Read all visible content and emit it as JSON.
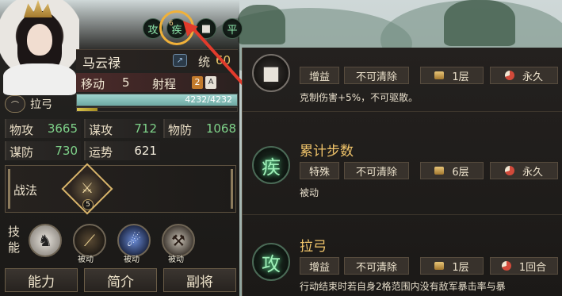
{
  "character": {
    "name": "马云禄",
    "leadership_label": "统",
    "leadership_value": "60",
    "move_label": "移动",
    "move_value": "5",
    "range_label": "射程",
    "range_value": "2",
    "range_extra": "A",
    "hp_text": "4232/4232",
    "hp_fraction": 1.0,
    "xp_fraction": 0.13,
    "weapon_label": "拉弓",
    "weapon_icon": "bow-icon"
  },
  "stats": [
    {
      "label": "物攻",
      "value": "3665",
      "color": "green"
    },
    {
      "label": "谋攻",
      "value": "712",
      "color": "green"
    },
    {
      "label": "物防",
      "value": "1068",
      "color": "green"
    },
    {
      "label": "谋防",
      "value": "730",
      "color": "green"
    },
    {
      "label": "运势",
      "value": "621",
      "color": "white"
    }
  ],
  "tactic": {
    "label": "战法",
    "level": "5",
    "icon": "spear-tactic-icon"
  },
  "skills": {
    "title": "技能",
    "items": [
      {
        "icon": "spear-rider-icon",
        "tag": ""
      },
      {
        "icon": "blade-icon",
        "tag": "被动"
      },
      {
        "icon": "slash-icon",
        "tag": "被动"
      },
      {
        "icon": "warrior-icon",
        "tag": "被动"
      }
    ]
  },
  "tabs": [
    "能力",
    "简介",
    "副将"
  ],
  "status_icons": [
    {
      "glyph": "攻",
      "name": "attack-status-icon"
    },
    {
      "glyph": "疾",
      "name": "swift-status-icon",
      "count": "6"
    },
    {
      "glyph": "■",
      "name": "buff-status-icon"
    },
    {
      "glyph": "平",
      "name": "calm-status-icon"
    }
  ],
  "effects": [
    {
      "name": "",
      "icon_glyph": "■",
      "type": "增益",
      "dispel": "不可清除",
      "layers": "1层",
      "duration": "永久",
      "desc": "克制伤害+5%，不可驱散。"
    },
    {
      "name": "累计步数",
      "icon_glyph": "疾",
      "type": "特殊",
      "dispel": "不可清除",
      "layers": "6层",
      "duration": "永久",
      "desc": "被动"
    },
    {
      "name": "拉弓",
      "icon_glyph": "攻",
      "type": "增益",
      "dispel": "不可清除",
      "layers": "1层",
      "duration": "1回合",
      "desc": "行动结束时若自身2格范围内没有敌军暴击率与暴"
    }
  ],
  "colors": {
    "accent_gold": "#f0c46a",
    "stat_green": "#7fd38a",
    "highlight_ring": "#f0b13a",
    "arrow_red": "#e23b2c"
  }
}
